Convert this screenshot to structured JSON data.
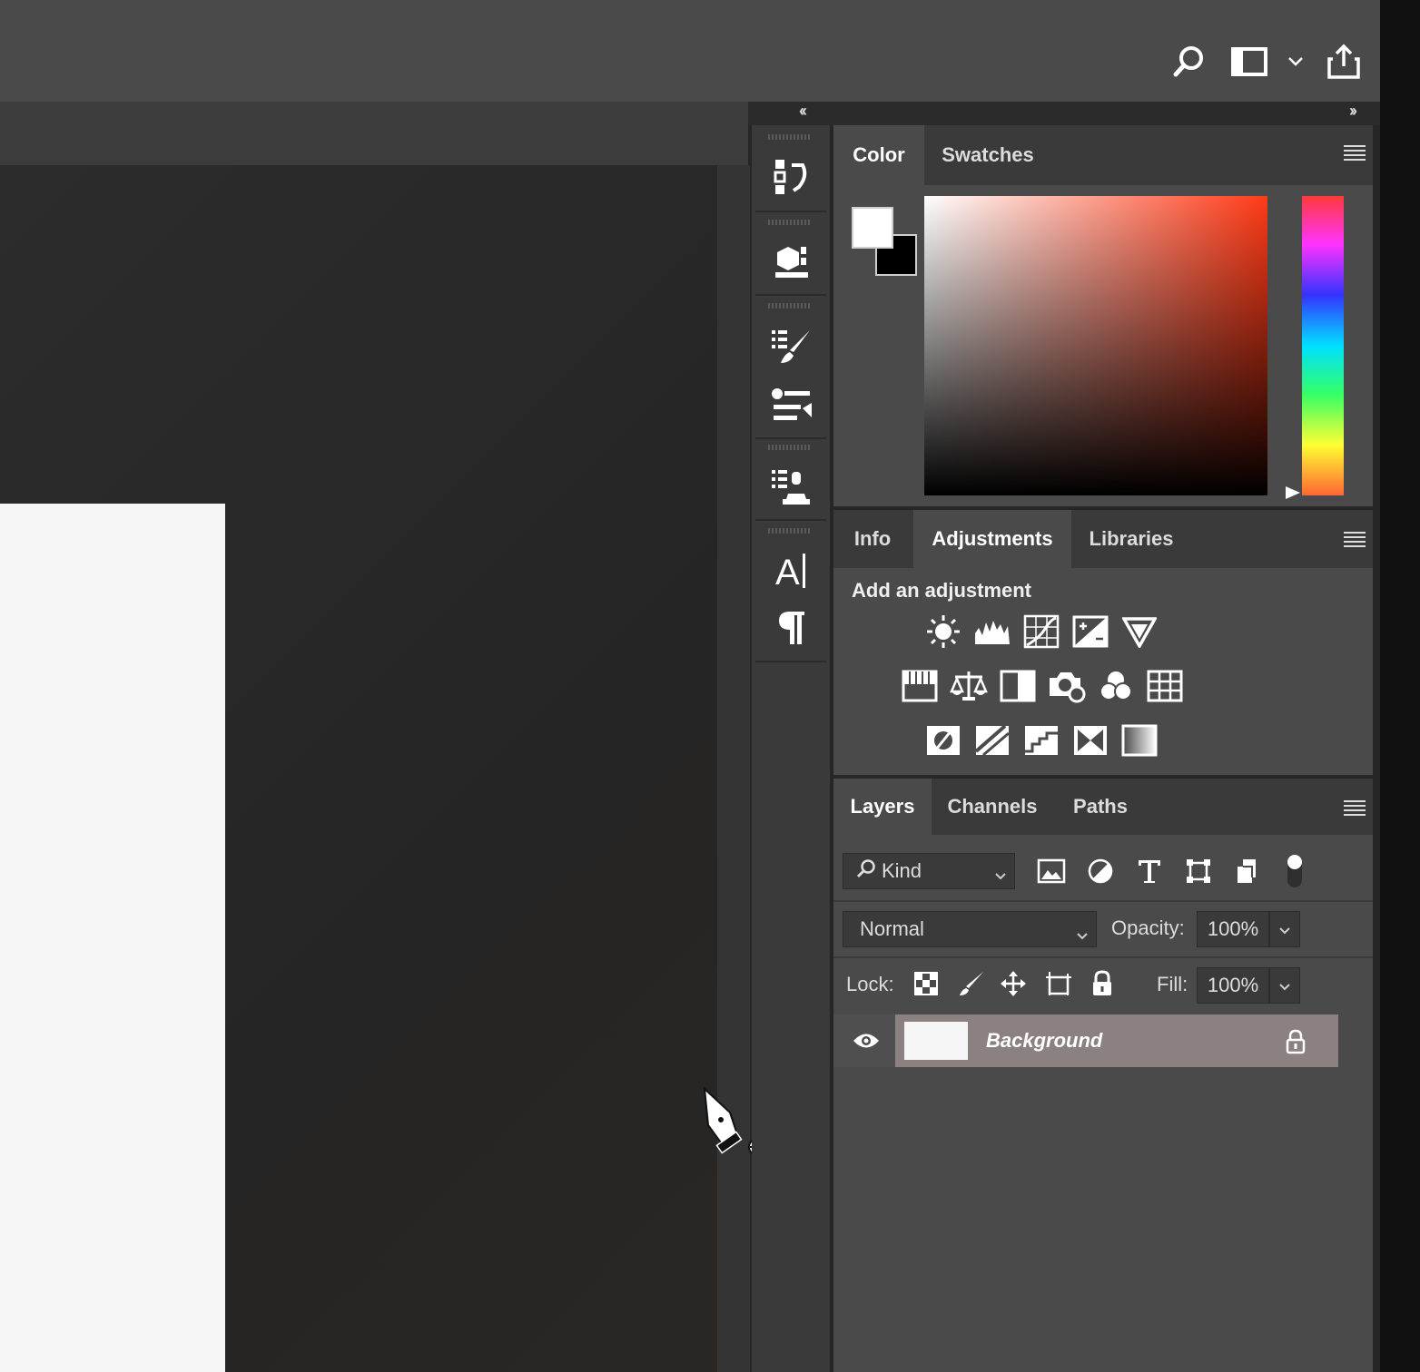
{
  "color_panel": {
    "tabs": [
      "Color",
      "Swatches"
    ],
    "foreground_color": "#ffffff",
    "background_color": "#000000",
    "field_hue": "#ff3a16"
  },
  "adjustments_panel": {
    "tabs": [
      "Info",
      "Adjustments",
      "Libraries"
    ],
    "heading": "Add an adjustment",
    "icons_row1": [
      "brightness-contrast-icon",
      "levels-icon",
      "curves-icon",
      "exposure-icon",
      "vibrance-icon"
    ],
    "icons_row2": [
      "hue-saturation-icon",
      "color-balance-icon",
      "black-white-icon",
      "photo-filter-icon",
      "channel-mixer-icon",
      "color-lookup-icon"
    ],
    "icons_row3": [
      "invert-icon",
      "posterize-icon",
      "threshold-icon",
      "selective-color-icon",
      "gradient-map-icon"
    ]
  },
  "layers_panel": {
    "tabs": [
      "Layers",
      "Channels",
      "Paths"
    ],
    "filter_kind": "Kind",
    "blend_mode": "Normal",
    "opacity_label": "Opacity:",
    "opacity_value": "100%",
    "lock_label": "Lock:",
    "fill_label": "Fill:",
    "fill_value": "100%",
    "layers": [
      {
        "name": "Background",
        "visible": true,
        "locked": true
      }
    ]
  }
}
